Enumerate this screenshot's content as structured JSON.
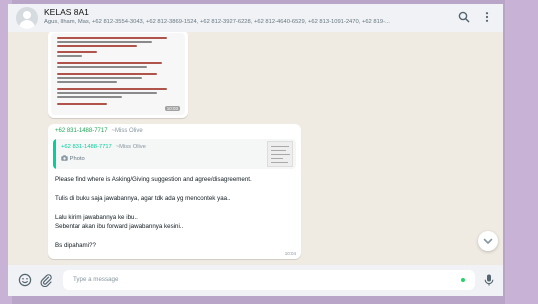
{
  "header": {
    "title": "KELAS 8A1",
    "participants": "Agus, Ilham, Mas, +62 812-3554-3043, +62 812-3869-1524, +62 812-3927-6228, +62 812-4640-6529, +62 813-1091-2470, +62 819-..."
  },
  "messages": {
    "image_time": "10:03",
    "sender_number": "+62 831-1488-7717",
    "sender_alias": "~Miss Olive",
    "quoted": {
      "sender_number": "+62 831-1488-7717",
      "sender_alias": "~Miss Olive",
      "type": "Photo"
    },
    "lines": [
      "Please find where is Asking/Giving suggestion and agree/disagreement.",
      "Tulis di buku saja jawabannya, agar tdk ada yg mencontek yaa..",
      "Lalu kirim jawabannya ke ibu..",
      "Sebentar akan ibu forward jawabannya kesini..",
      "Bs dipahami??"
    ],
    "time": "10:04"
  },
  "composer": {
    "placeholder": "Type a message"
  },
  "colors": {
    "accent_green": "#1fa855",
    "quote_green": "#06cf9c",
    "chat_bg": "#efeae2",
    "panel_bg": "#f0f2f5"
  },
  "icons": [
    "search-icon",
    "menu-icon",
    "emoji-icon",
    "attach-icon",
    "mic-icon",
    "chevron-down-icon",
    "camera-icon"
  ]
}
